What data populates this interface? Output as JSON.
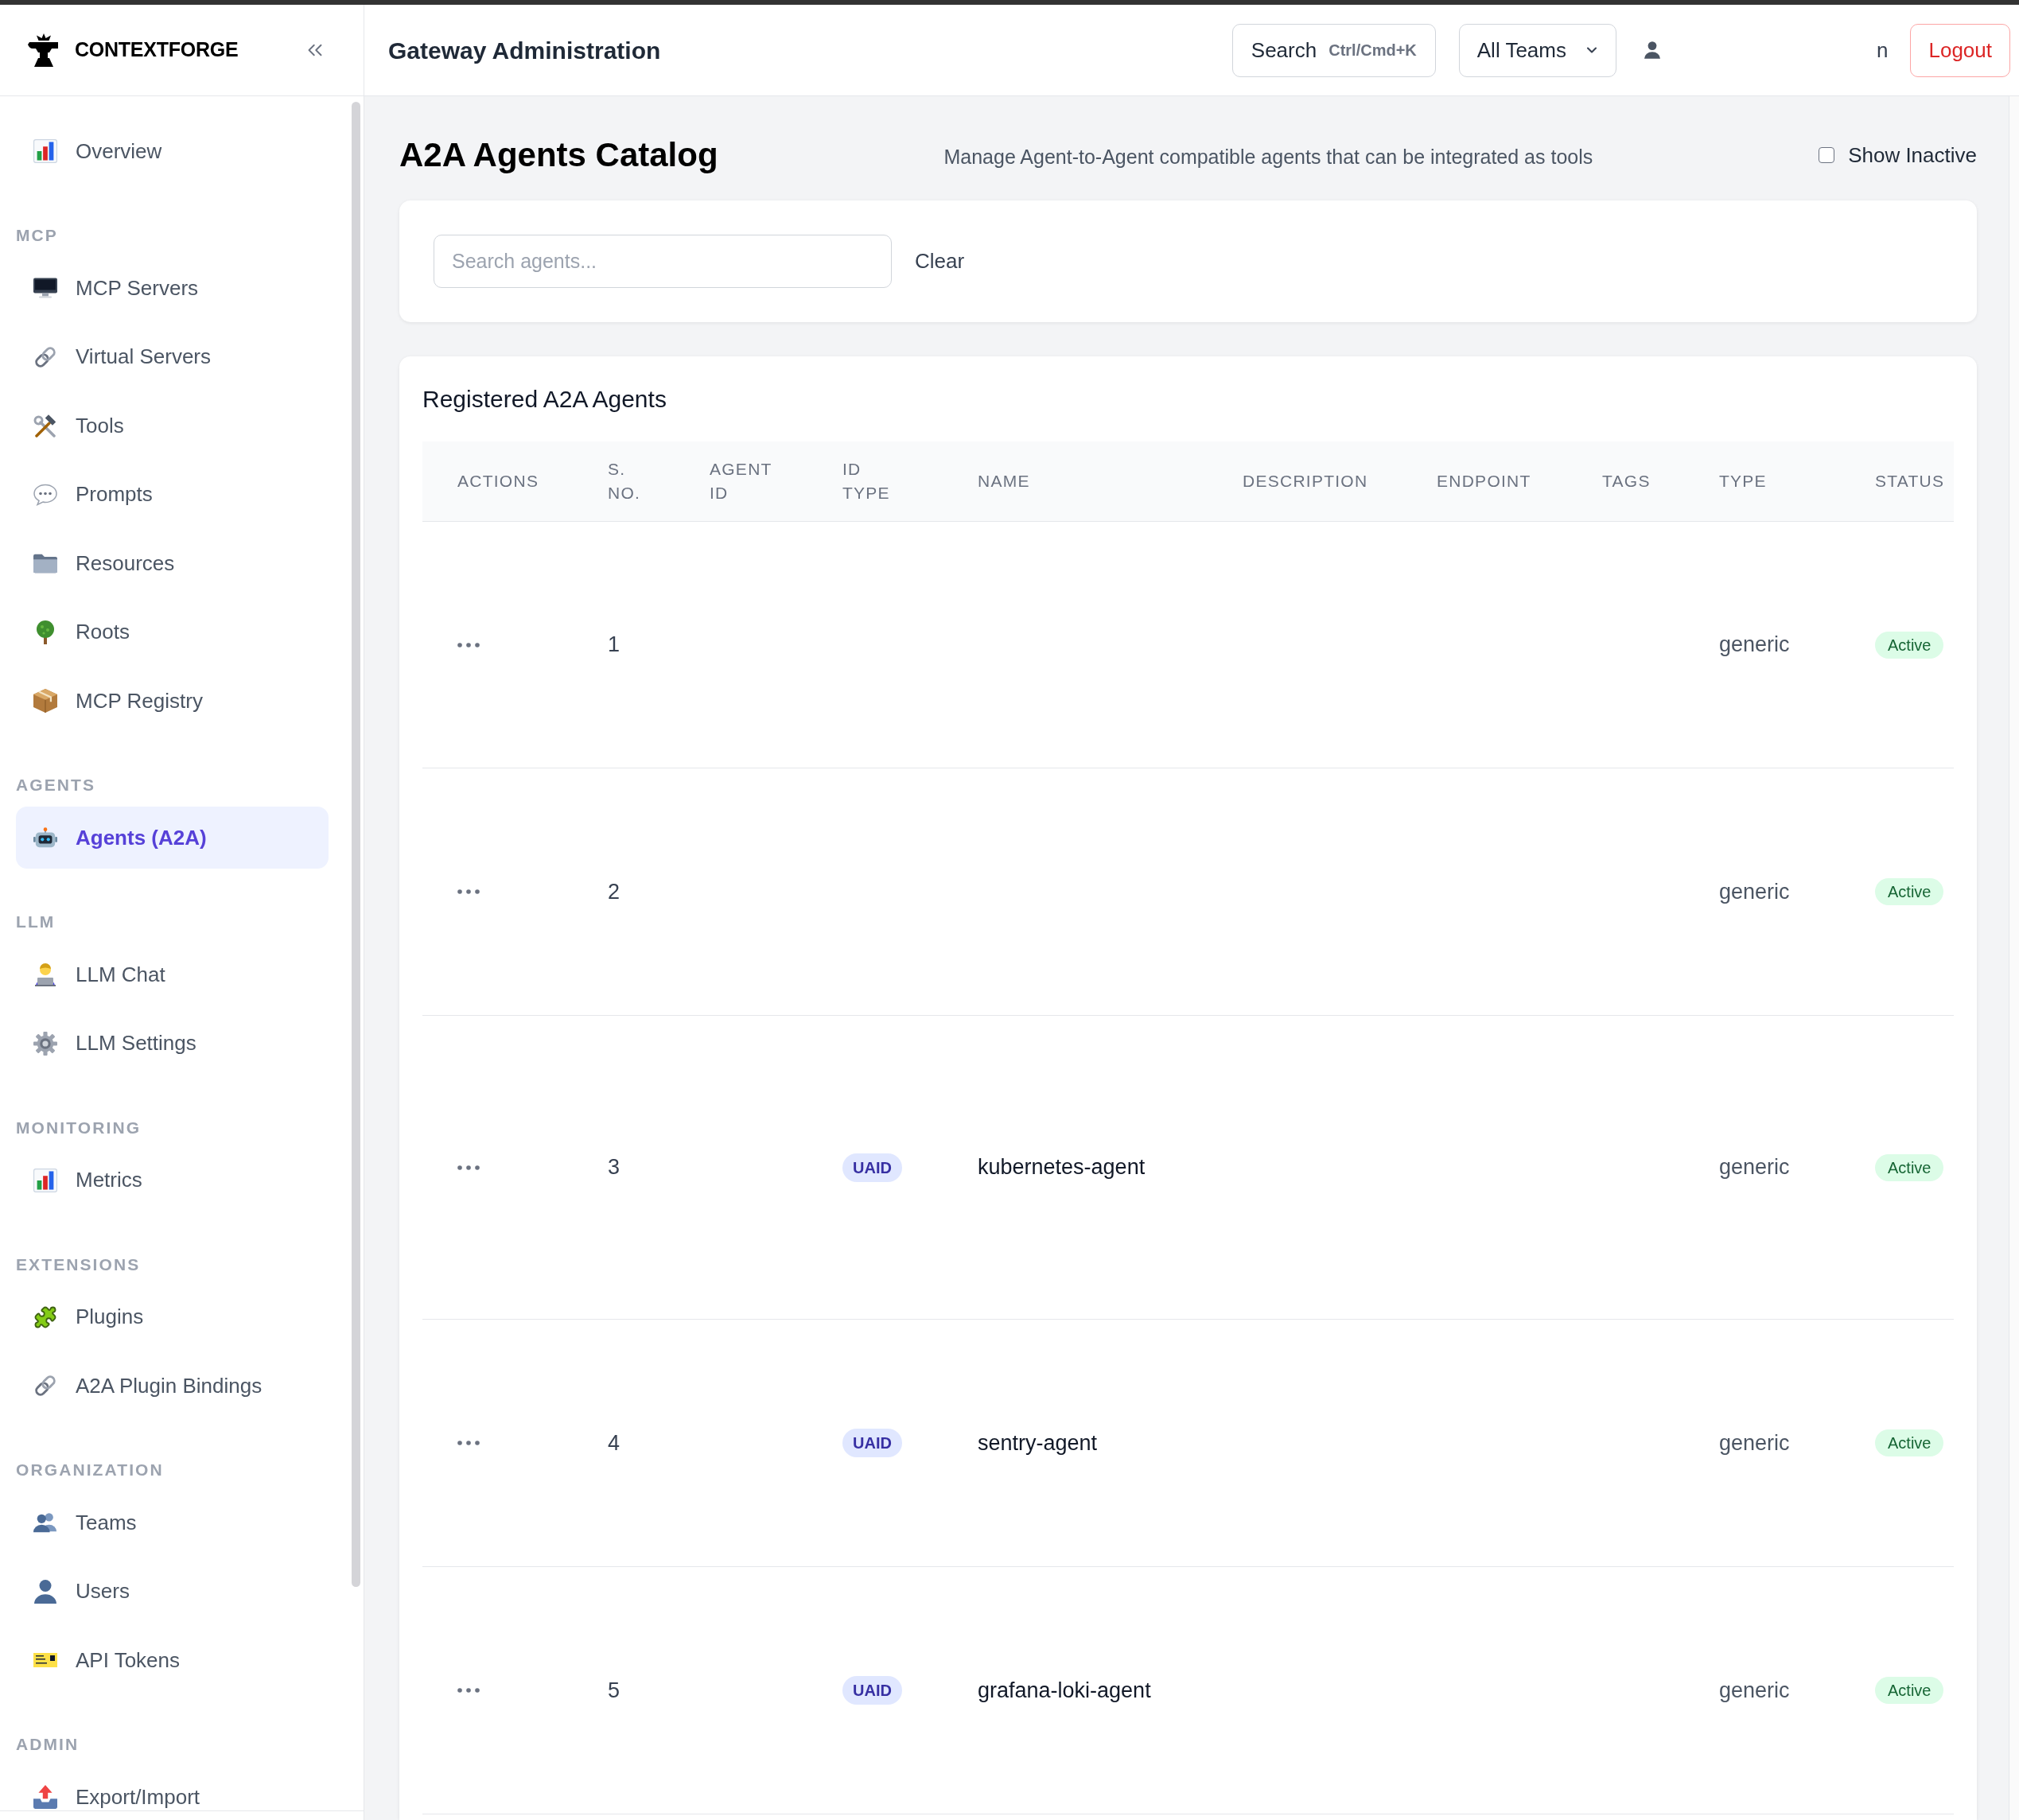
{
  "sidebar": {
    "logo": "CONTEXTFORGE",
    "items": [
      {
        "label": "Overview",
        "selected": false
      }
    ],
    "sections": [
      {
        "heading": "MCP",
        "items": [
          {
            "label": "MCP Servers",
            "selected": false
          },
          {
            "label": "Virtual Servers",
            "selected": false
          },
          {
            "label": "Tools",
            "selected": false
          },
          {
            "label": "Prompts",
            "selected": false
          },
          {
            "label": "Resources",
            "selected": false
          },
          {
            "label": "Roots",
            "selected": false
          },
          {
            "label": "MCP Registry",
            "selected": false
          }
        ]
      },
      {
        "heading": "AGENTS",
        "items": [
          {
            "label": "Agents (A2A)",
            "selected": true
          }
        ]
      },
      {
        "heading": "LLM",
        "items": [
          {
            "label": "LLM Chat",
            "selected": false
          },
          {
            "label": "LLM Settings",
            "selected": false
          }
        ]
      },
      {
        "heading": "MONITORING",
        "items": [
          {
            "label": "Metrics",
            "selected": false
          }
        ]
      },
      {
        "heading": "EXTENSIONS",
        "items": [
          {
            "label": "Plugins",
            "selected": false
          },
          {
            "label": "A2A Plugin Bindings",
            "selected": false
          }
        ]
      },
      {
        "heading": "ORGANIZATION",
        "items": [
          {
            "label": "Teams",
            "selected": false
          },
          {
            "label": "Users",
            "selected": false
          },
          {
            "label": "API Tokens",
            "selected": false
          }
        ]
      },
      {
        "heading": "ADMIN",
        "items": [
          {
            "label": "Export/Import",
            "selected": false
          }
        ]
      }
    ]
  },
  "header": {
    "title": "Gateway Administration",
    "search": {
      "label": "Search",
      "shortcut": "Ctrl/Cmd+K"
    },
    "team_selector": "All Teams",
    "user_name": "n",
    "logout": "Logout"
  },
  "page": {
    "title": "A2A Agents Catalog",
    "description": "Manage Agent-to-Agent compatible agents that can be integrated as tools",
    "show_inactive": {
      "label": "Show Inactive",
      "checked": false
    }
  },
  "search": {
    "placeholder": "Search agents...",
    "clear": "Clear"
  },
  "table": {
    "title": "Registered A2A Agents",
    "columns": [
      "ACTIONS",
      "S. NO.",
      "AGENT ID",
      "ID TYPE",
      "NAME",
      "DESCRIPTION",
      "ENDPOINT",
      "TAGS",
      "TYPE",
      "STATUS"
    ],
    "rows": [
      {
        "s_no": "1",
        "type": "generic",
        "status": "Active"
      },
      {
        "s_no": "2",
        "type": "generic",
        "status": "Active"
      },
      {
        "s_no": "3",
        "id_type": "UAID",
        "name": "kubernetes-agent",
        "type": "generic",
        "status": "Active"
      },
      {
        "s_no": "4",
        "id_type": "UAID",
        "name": "sentry-agent",
        "type": "generic",
        "status": "Active"
      },
      {
        "s_no": "5",
        "id_type": "UAID",
        "name": "grafana-loki-agent",
        "type": "generic",
        "status": "Active"
      }
    ]
  }
}
